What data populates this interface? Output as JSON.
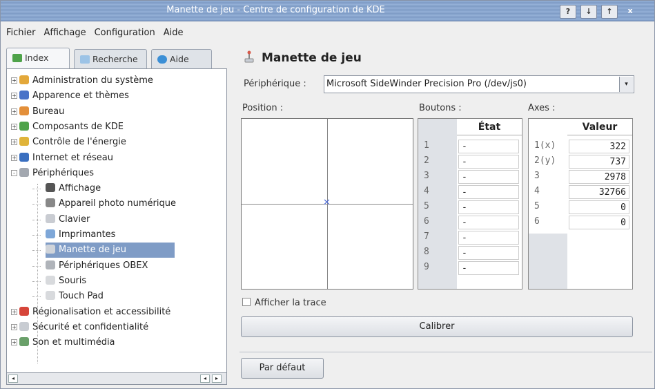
{
  "window": {
    "title": "Manette de jeu - Centre de configuration de KDE",
    "title_buttons": [
      "?",
      "↓",
      "↑",
      "x"
    ]
  },
  "menubar": [
    "Fichier",
    "Affichage",
    "Configuration",
    "Aide"
  ],
  "sidebar": {
    "tabs": [
      {
        "label": "Index",
        "icon": "index-icon"
      },
      {
        "label": "Recherche",
        "icon": "search-icon"
      },
      {
        "label": "Aide",
        "icon": "help-icon"
      }
    ],
    "tree": [
      {
        "label": "Administration du système",
        "icon": "system-admin-icon",
        "expander": "+"
      },
      {
        "label": "Apparence et thèmes",
        "icon": "appearance-icon",
        "expander": "+"
      },
      {
        "label": "Bureau",
        "icon": "desktop-icon",
        "expander": "+"
      },
      {
        "label": "Composants de KDE",
        "icon": "kde-components-icon",
        "expander": "+"
      },
      {
        "label": "Contrôle de l'énergie",
        "icon": "power-icon",
        "expander": "+"
      },
      {
        "label": "Internet et réseau",
        "icon": "network-icon",
        "expander": "+"
      },
      {
        "label": "Périphériques",
        "icon": "peripherals-icon",
        "expander": "-"
      },
      {
        "label": "Affichage",
        "icon": "display-icon",
        "child": true
      },
      {
        "label": "Appareil photo numérique",
        "icon": "camera-icon",
        "child": true
      },
      {
        "label": "Clavier",
        "icon": "keyboard-icon",
        "child": true
      },
      {
        "label": "Imprimantes",
        "icon": "printer-icon",
        "child": true
      },
      {
        "label": "Manette de jeu",
        "icon": "joystick-icon",
        "child": true,
        "selected": true
      },
      {
        "label": "Périphériques OBEX",
        "icon": "obex-icon",
        "child": true
      },
      {
        "label": "Souris",
        "icon": "mouse-icon",
        "child": true
      },
      {
        "label": "Touch Pad",
        "icon": "touchpad-icon",
        "child": true
      },
      {
        "label": "Régionalisation et accessibilité",
        "icon": "regional-icon",
        "expander": "+"
      },
      {
        "label": "Sécurité et confidentialité",
        "icon": "security-icon",
        "expander": "+"
      },
      {
        "label": "Son et multimédia",
        "icon": "sound-icon",
        "expander": "+"
      }
    ]
  },
  "main": {
    "title": "Manette de jeu",
    "device_label": "Périphérique :",
    "device_value": "Microsoft SideWinder Precision Pro (/dev/js0)",
    "position_label": "Position :",
    "buttons_label": "Boutons :",
    "axes_label": "Axes :",
    "buttons_table": {
      "header": "État",
      "rows": [
        {
          "n": "1",
          "v": "-"
        },
        {
          "n": "2",
          "v": "-"
        },
        {
          "n": "3",
          "v": "-"
        },
        {
          "n": "4",
          "v": "-"
        },
        {
          "n": "5",
          "v": "-"
        },
        {
          "n": "6",
          "v": "-"
        },
        {
          "n": "7",
          "v": "-"
        },
        {
          "n": "8",
          "v": "-"
        },
        {
          "n": "9",
          "v": "-"
        }
      ]
    },
    "axes_table": {
      "header": "Valeur",
      "rows": [
        {
          "n": "1(x)",
          "v": "322"
        },
        {
          "n": "2(y)",
          "v": "737"
        },
        {
          "n": "3",
          "v": "2978"
        },
        {
          "n": "4",
          "v": "32766"
        },
        {
          "n": "5",
          "v": "0"
        },
        {
          "n": "6",
          "v": "0"
        }
      ]
    },
    "trace_label": "Afficher la trace",
    "calibrate_label": "Calibrer",
    "default_label": "Par défaut"
  }
}
